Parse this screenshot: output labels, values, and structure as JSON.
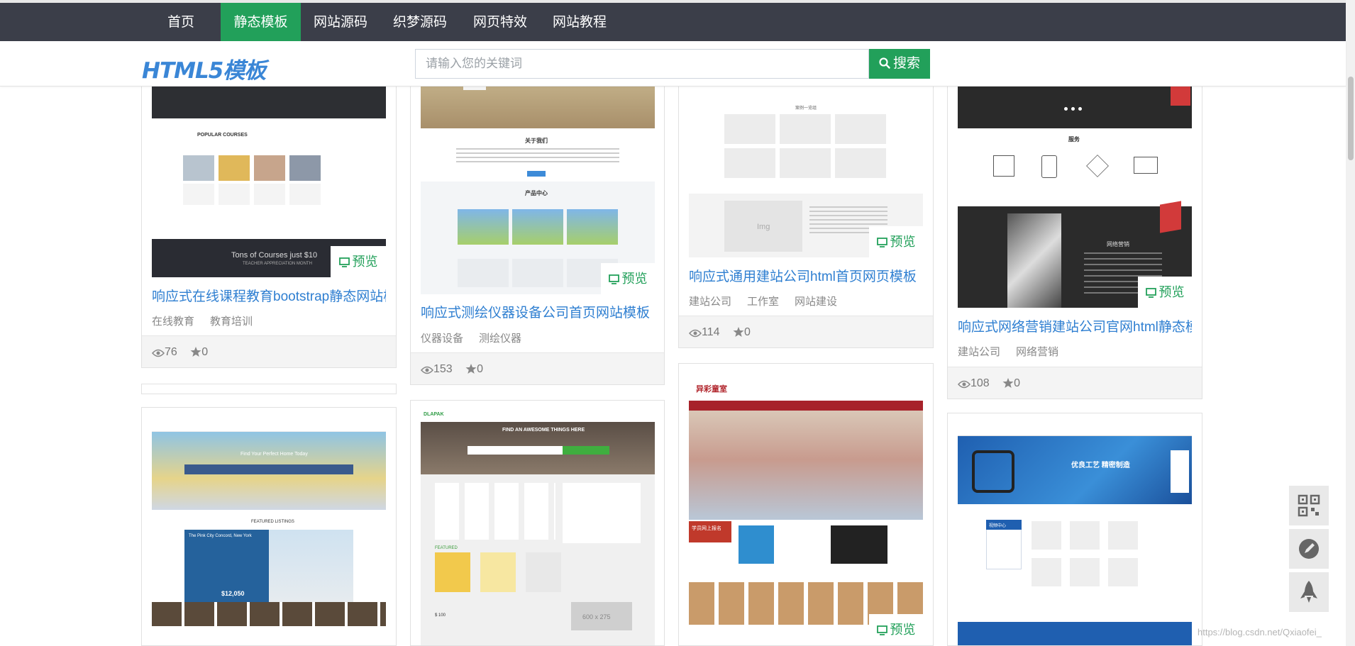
{
  "nav": {
    "items": [
      {
        "label": "首页"
      },
      {
        "label": "静态模板"
      },
      {
        "label": "网站源码"
      },
      {
        "label": "织梦源码"
      },
      {
        "label": "网页特效"
      },
      {
        "label": "网站教程"
      }
    ]
  },
  "header": {
    "logo": "HTML5模板",
    "search_placeholder": "请输入您的关键词",
    "search_button": "搜索"
  },
  "preview_label": "预览",
  "cards": [
    {
      "title": "响应式在线课程教育bootstrap静态网站模",
      "tags": [
        "在线教育",
        "教育培训"
      ],
      "views": "76",
      "stars": "0",
      "thumb": {
        "heading": "POPULAR COURSES",
        "banner": "Tons of Courses just $10",
        "banner_sub": "TEACHER APPRECIATION MONTH"
      }
    },
    {
      "title": "响应式测绘仪器设备公司首页网站模板",
      "tags": [
        "仪器设备",
        "测绘仪器"
      ],
      "views": "153",
      "stars": "0",
      "thumb": {
        "section1": "关于我们",
        "section2": "产品中心"
      }
    },
    {
      "title": "响应式通用建站公司html首页网页模板",
      "tags": [
        "建站公司",
        "工作室",
        "网站建设"
      ],
      "views": "114",
      "stars": "0",
      "thumb": {
        "heading": "案例一览组",
        "img_label": "Img"
      }
    },
    {
      "title": "响应式网络营销建站公司官网html静态模",
      "tags": [
        "建站公司",
        "网络营销"
      ],
      "views": "108",
      "stars": "0",
      "thumb": {
        "section1": "服务",
        "section2": "网络营销"
      }
    },
    {
      "thumb": {
        "hero": "Find Your Perfect Home Today",
        "listings": "FEATURED LISTINGS",
        "listing_name": "The Pink City Concord, New York",
        "price": "$12,050"
      }
    },
    {
      "thumb": {
        "brand": "DLAPAK",
        "hero": "FIND AN AWESOME THINGS HERE",
        "featured": "FEATURED",
        "placeholder": "600 x 275",
        "price": "$ 100"
      }
    },
    {
      "thumb": {
        "brand": "异彩童室",
        "signup": "学员网上报名"
      }
    },
    {
      "thumb": {
        "hero": "优良工艺 精密制造",
        "center": "视频中心"
      }
    }
  ],
  "watermark": "https://blog.csdn.net/Qxiaofei_",
  "side_tools": [
    {
      "icon": "qrcode-icon"
    },
    {
      "icon": "feedback-icon"
    },
    {
      "icon": "rocket-icon"
    }
  ]
}
